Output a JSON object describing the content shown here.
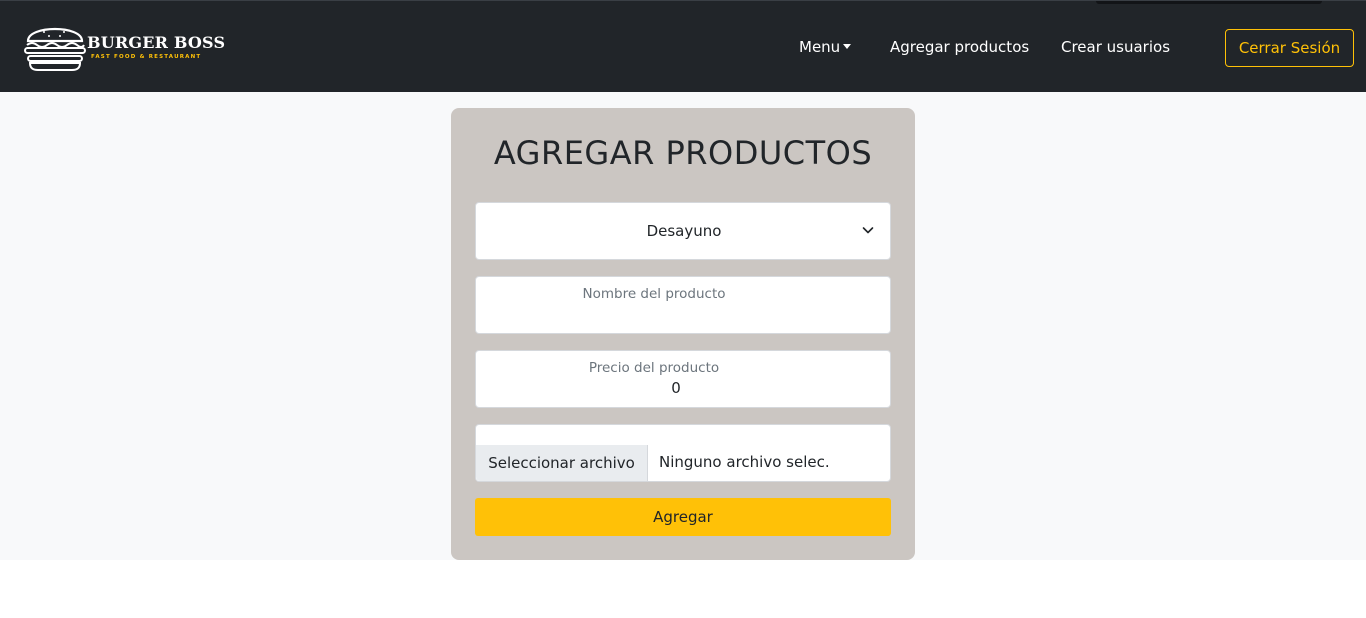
{
  "brand": {
    "name": "BURGER BOSS",
    "tagline": "FAST FOOD & RESTAURANT",
    "logo_icon": "burger-icon"
  },
  "nav": {
    "menu_label": "Menu",
    "add_products_label": "Agregar productos",
    "create_users_label": "Crear usuarios",
    "logout_label": "Cerrar Sesión"
  },
  "form": {
    "title": "AGREGAR PRODUCTOS",
    "category_selected": "Desayuno",
    "name_label": "Nombre del producto",
    "name_value": "",
    "price_label": "Precio del producto",
    "price_value": "0",
    "file_button_label": "Seleccionar archivo",
    "file_status": "Ninguno archivo selec.",
    "submit_label": "Agregar"
  },
  "colors": {
    "navbar": "#212529",
    "accent": "#ffc107",
    "card": "#cbc6c2",
    "page_bg": "#f8f9fa"
  }
}
